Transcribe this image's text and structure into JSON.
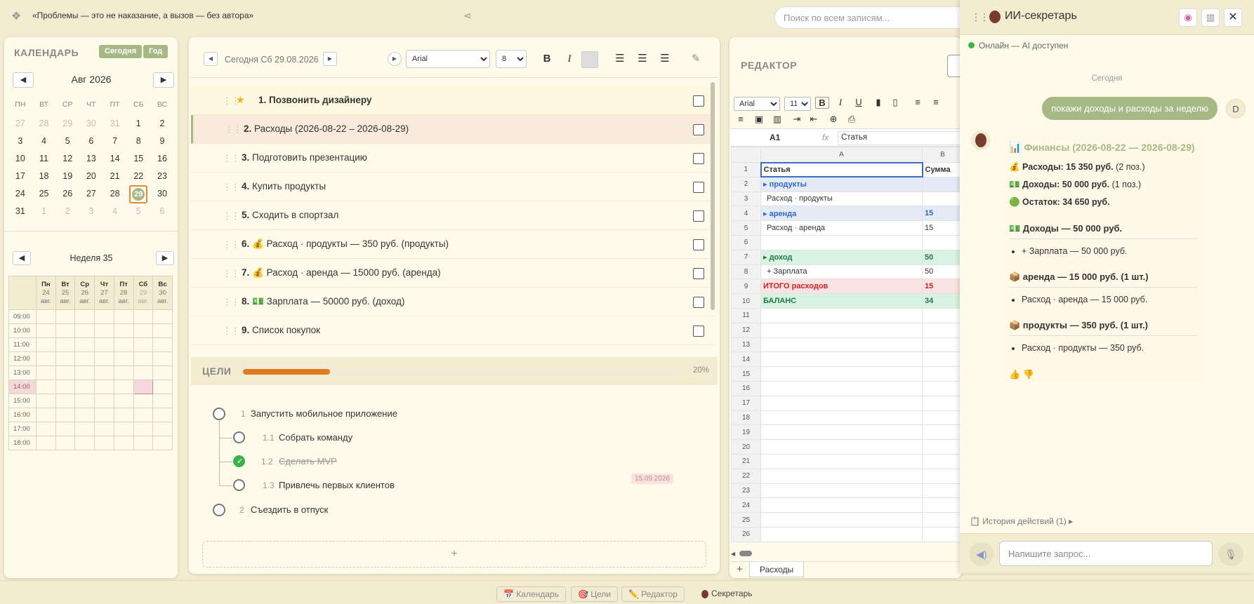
{
  "topbar": {
    "quote": "«Проблемы — это не наказание, а вызов — без автора»",
    "search_placeholder": "Поиск по всем записям..."
  },
  "calendar": {
    "title": "КАЛЕНДАРЬ",
    "today_btn": "Сегодня",
    "year_btn": "Год",
    "month": "Авг 2026",
    "weekdays": [
      "ПН",
      "ВТ",
      "СР",
      "ЧТ",
      "ПТ",
      "СБ",
      "ВС"
    ],
    "weeks": [
      [
        "27",
        "28",
        "29",
        "30",
        "31",
        "1",
        "2"
      ],
      [
        "3",
        "4",
        "5",
        "6",
        "7",
        "8",
        "9"
      ],
      [
        "10",
        "11",
        "12",
        "13",
        "14",
        "15",
        "16"
      ],
      [
        "17",
        "18",
        "19",
        "20",
        "21",
        "22",
        "23"
      ],
      [
        "24",
        "25",
        "26",
        "27",
        "28",
        "29",
        "30"
      ],
      [
        "31",
        "1",
        "2",
        "3",
        "4",
        "5",
        "6"
      ]
    ],
    "week_label": "Неделя 35",
    "week_days": [
      {
        "d": "Пн",
        "n": "24",
        "m": "авг."
      },
      {
        "d": "Вт",
        "n": "25",
        "m": "авг."
      },
      {
        "d": "Ср",
        "n": "26",
        "m": "авг."
      },
      {
        "d": "Чт",
        "n": "27",
        "m": "авг."
      },
      {
        "d": "Пт",
        "n": "28",
        "m": "авг."
      },
      {
        "d": "Сб",
        "n": "29",
        "m": "авг."
      },
      {
        "d": "Вс",
        "n": "30",
        "m": "авг."
      }
    ],
    "hours": [
      "09:00",
      "10:00",
      "11:00",
      "12:00",
      "13:00",
      "14:00",
      "15:00",
      "16:00",
      "17:00",
      "18:00"
    ]
  },
  "tasks": {
    "date": "Сегодня Сб 29.08.2026",
    "font": "Arial",
    "size": "8",
    "items": [
      {
        "num": "1.",
        "text": "Позвонить дизайнеру"
      },
      {
        "num": "2.",
        "text": "Расходы (2026-08-22 – 2026-08-29)"
      },
      {
        "num": "3.",
        "text": "Подготовить презентацию"
      },
      {
        "num": "4.",
        "text": "Купить продукты"
      },
      {
        "num": "5.",
        "text": "Сходить в спортзал"
      },
      {
        "num": "6.",
        "text": "💰 Расход · продукты — 350 руб. (продукты)"
      },
      {
        "num": "7.",
        "text": "💰 Расход · аренда — 15000 руб. (аренда)"
      },
      {
        "num": "8.",
        "text": "💵 Зарплата — 50000 руб. (доход)"
      },
      {
        "num": "9.",
        "text": "Список покупок"
      }
    ]
  },
  "goals": {
    "title": "ЦЕЛИ",
    "progress": "20%",
    "progress_value": 0.2,
    "items": [
      {
        "num": "1",
        "text": "Запустить мобильное приложение"
      },
      {
        "num": "1.1",
        "text": "Собрать команду"
      },
      {
        "num": "1.2",
        "text": "Сделать MVP"
      },
      {
        "num": "1.3",
        "text": "Привлечь первых клиентов",
        "due": "15.09.2026"
      },
      {
        "num": "2",
        "text": "Съездить в отпуск"
      }
    ],
    "add": "+"
  },
  "editor": {
    "title": "РЕДАКТОР",
    "font": "Arial",
    "size": "11",
    "cell_ref": "A1",
    "fx": "fx",
    "formula": "Статья",
    "cols": [
      "A",
      "B"
    ],
    "rows": [
      {
        "n": "1",
        "a": "Статья",
        "b": "Сумма"
      },
      {
        "n": "2",
        "a": "▸ продукты",
        "b": ""
      },
      {
        "n": "3",
        "a": "Расход · продукты",
        "b": ""
      },
      {
        "n": "4",
        "a": "▸ аренда",
        "b": "15"
      },
      {
        "n": "5",
        "a": "Расход · аренда",
        "b": "15"
      },
      {
        "n": "6",
        "a": "",
        "b": ""
      },
      {
        "n": "7",
        "a": "▸ доход",
        "b": "50"
      },
      {
        "n": "8",
        "a": "+ Зарплата",
        "b": "50"
      },
      {
        "n": "9",
        "a": "ИТОГО расходов",
        "b": "15"
      },
      {
        "n": "10",
        "a": "БАЛАНС",
        "b": "34"
      },
      {
        "n": "11"
      },
      {
        "n": "12"
      },
      {
        "n": "13"
      },
      {
        "n": "14"
      },
      {
        "n": "15"
      },
      {
        "n": "16"
      },
      {
        "n": "17"
      },
      {
        "n": "18"
      },
      {
        "n": "19"
      },
      {
        "n": "20"
      },
      {
        "n": "21"
      },
      {
        "n": "22"
      },
      {
        "n": "23"
      },
      {
        "n": "24"
      },
      {
        "n": "25"
      },
      {
        "n": "26"
      }
    ],
    "add_sheet": "+",
    "sheet_tab": "Расходы"
  },
  "assistant": {
    "title": "ИИ-секретарь",
    "status": "Онлайн — AI доступен",
    "day": "Сегодня",
    "user_msg": "покажи доходы и расходы за неделю",
    "user_avatar": "D",
    "reply": {
      "title": "📊 Финансы (2026-08-22 — 2026-08-29)",
      "exp_label": "💰 Расходы: 15 350 руб.",
      "exp_count": "(2 поз.)",
      "inc_label": "💵 Доходы: 50 000 руб.",
      "inc_count": "(1 поз.)",
      "bal_label": "🟢 Остаток: 34 650 руб.",
      "s1": "💵 Доходы — 50 000 руб.",
      "s1_item": "+ Зарплата — 50 000 руб.",
      "s2": "📦 аренда — 15 000 руб. (1 шт.)",
      "s2_item": "Расход · аренда — 15 000 руб.",
      "s3": "📦 продукты — 350 руб. (1 шт.)",
      "s3_item": "Расход · продукты — 350 руб."
    },
    "history": "📋 История действий (1) ▸",
    "input_placeholder": "Напишите запрос..."
  },
  "dock": {
    "calendar": "📅 Календарь",
    "goals": "🎯 Цели",
    "editor": "✏️ Редактор",
    "secretary": "Секретарь"
  }
}
